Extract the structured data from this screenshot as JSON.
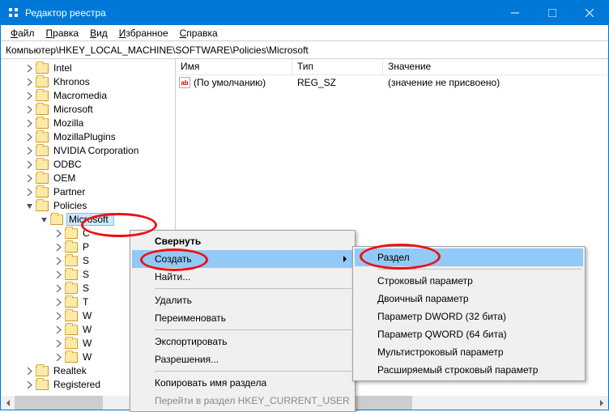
{
  "titlebar": {
    "title": "Редактор реестра"
  },
  "menubar": {
    "file": "Файл",
    "edit": "Правка",
    "view": "Вид",
    "favorites": "Избранное",
    "help": "Справка"
  },
  "address": "Компьютер\\HKEY_LOCAL_MACHINE\\SOFTWARE\\Policies\\Microsoft",
  "tree": {
    "items": [
      {
        "label": "Intel",
        "depth": 0
      },
      {
        "label": "Khronos",
        "depth": 0
      },
      {
        "label": "Macromedia",
        "depth": 0
      },
      {
        "label": "Microsoft",
        "depth": 0
      },
      {
        "label": "Mozilla",
        "depth": 0
      },
      {
        "label": "MozillaPlugins",
        "depth": 0
      },
      {
        "label": "NVIDIA Corporation",
        "depth": 0
      },
      {
        "label": "ODBC",
        "depth": 0
      },
      {
        "label": "OEM",
        "depth": 0
      },
      {
        "label": "Partner",
        "depth": 0
      },
      {
        "label": "Policies",
        "depth": 0,
        "expanded": true
      },
      {
        "label": "Microsoft",
        "depth": 1,
        "expanded": true,
        "selected": true
      },
      {
        "label": "C",
        "depth": 2
      },
      {
        "label": "P",
        "depth": 2
      },
      {
        "label": "S",
        "depth": 2
      },
      {
        "label": "S",
        "depth": 2
      },
      {
        "label": "S",
        "depth": 2
      },
      {
        "label": "T",
        "depth": 2
      },
      {
        "label": "W",
        "depth": 2
      },
      {
        "label": "W",
        "depth": 2
      },
      {
        "label": "W",
        "depth": 2
      },
      {
        "label": "W",
        "depth": 2
      },
      {
        "label": "Realtek",
        "depth": 0
      },
      {
        "label": "Registered",
        "depth": 0
      }
    ]
  },
  "list": {
    "cols": {
      "name": "Имя",
      "type": "Тип",
      "value": "Значение"
    },
    "rows": [
      {
        "name": "(По умолчанию)",
        "type": "REG_SZ",
        "value": "(значение не присвоено)"
      }
    ]
  },
  "ctx": {
    "collapse": "Свернуть",
    "create": "Создать",
    "find": "Найти...",
    "delete": "Удалить",
    "rename": "Переименовать",
    "export": "Экспортировать",
    "permissions": "Разрешения...",
    "copyname": "Копировать имя раздела",
    "gotohkcu": "Перейти в раздел HKEY_CURRENT_USER"
  },
  "sub": {
    "key": "Раздел",
    "string": "Строковый параметр",
    "binary": "Двоичный параметр",
    "dword": "Параметр DWORD (32 бита)",
    "qword": "Параметр QWORD (64 бита)",
    "multi": "Мультистроковый параметр",
    "expand": "Расширяемый строковый параметр"
  },
  "valicon": "ab"
}
